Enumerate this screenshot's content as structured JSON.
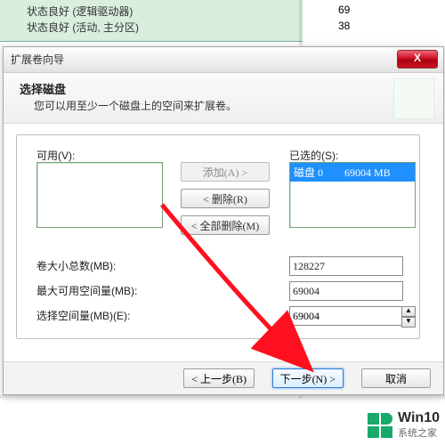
{
  "bg": {
    "row1_text": "状态良好 (逻辑驱动器)",
    "row1_num": "69",
    "row2_text": "状态良好 (活动, 主分区)",
    "row2_num": "38"
  },
  "window": {
    "title": "扩展卷向导",
    "close": "X"
  },
  "header": {
    "title": "选择磁盘",
    "subtitle": "您可以用至少一个磁盘上的空间来扩展卷。"
  },
  "lists": {
    "available_label": "可用(V):",
    "selected_label": "已选的(S):",
    "selected_item": "磁盘 0        69004 MB"
  },
  "buttons": {
    "add": "添加(A) >",
    "remove": "< 删除(R)",
    "remove_all": "< 全部删除(M)"
  },
  "fields": {
    "total_label": "卷大小总数(MB):",
    "total_value": "128227",
    "max_label": "最大可用空间量(MB):",
    "max_value": "69004",
    "select_label": "选择空间量(MB)(E):",
    "select_value": "69004"
  },
  "nav": {
    "back": "< 上一步(B)",
    "next": "下一步(N) >",
    "cancel": "取消"
  },
  "watermark": {
    "brand": "Win10",
    "site": "系统之家"
  }
}
